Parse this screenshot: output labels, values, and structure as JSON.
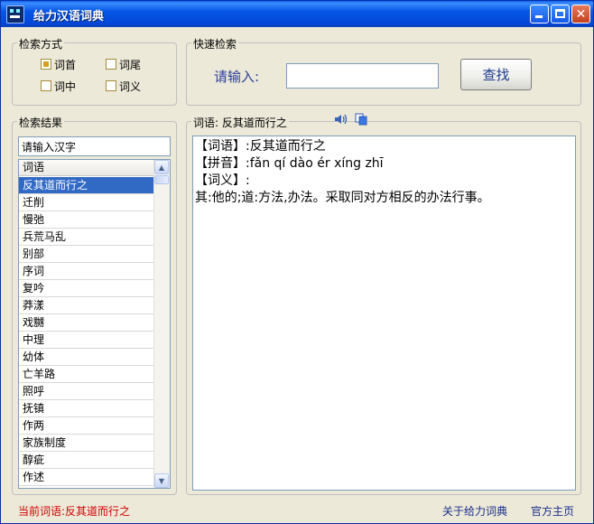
{
  "window": {
    "title": "给力汉语词典"
  },
  "search_mode": {
    "legend": "检索方式",
    "options": [
      {
        "label": "词首",
        "checked": true
      },
      {
        "label": "词尾",
        "checked": false
      },
      {
        "label": "词中",
        "checked": false
      },
      {
        "label": "词义",
        "checked": false
      }
    ]
  },
  "quick_search": {
    "legend": "快速检索",
    "prompt": "请输入:",
    "input_value": "",
    "button": "查找"
  },
  "results": {
    "legend": "检索结果",
    "filter_value": "请输入汉字",
    "column_header": "词语",
    "items": [
      "反其道而行之",
      "迁削",
      "慢弛",
      "兵荒马乱",
      "别部",
      "序词",
      "复吟",
      "莽漾",
      "戏嬲",
      "中理",
      "幼体",
      "亡羊路",
      "照呼",
      "抚镇",
      "作两",
      "家族制度",
      "醇疵",
      "作述"
    ],
    "selected_index": 0
  },
  "detail": {
    "label": "词语: 反其道而行之",
    "speaker_icon": "speaker-icon",
    "copy_icon": "copy-icon",
    "lines": [
      "【词语】:反其道而行之",
      "【拼音】:fǎn qí dào ér xíng zhī",
      "【词义】:",
      "其:他的;道:方法,办法。采取同对方相反的办法行事。"
    ]
  },
  "status": {
    "current": "当前词语:反其道而行之",
    "about_link": "关于给力词典",
    "home_link": "官方主页"
  }
}
